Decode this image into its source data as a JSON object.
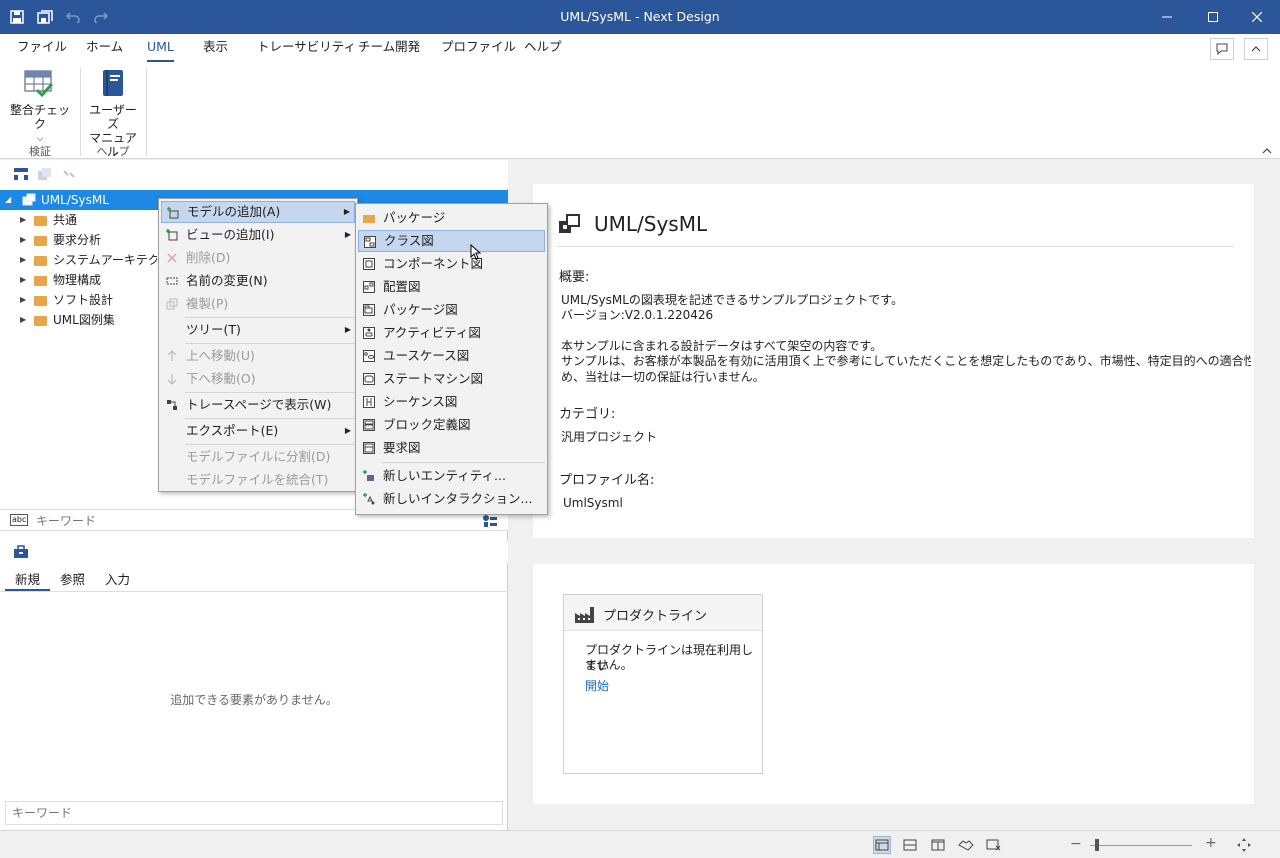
{
  "window": {
    "title": "UML/SysML - Next Design"
  },
  "menu": {
    "tabs": [
      "ファイル",
      "ホーム",
      "UML",
      "表示",
      "トレーサビリティ",
      "チーム開発",
      "プロファイル",
      "ヘルプ"
    ]
  },
  "ribbon": {
    "check_label_1": "整合チェック",
    "check_group": "検証",
    "manual_label_1": "ユーザーズ",
    "manual_label_2": "マニュアル",
    "help_group": "ヘルプ"
  },
  "tree": {
    "root": "UML/SysML",
    "items": [
      "共通",
      "要求分析",
      "システムアーキテクチャ",
      "物理構成",
      "ソフト設計",
      "UML図例集"
    ]
  },
  "context_menu": {
    "items": [
      {
        "label": "モデルの追加(A)"
      },
      {
        "label": "ビューの追加(I)"
      },
      {
        "label": "削除(D)"
      },
      {
        "label": "名前の変更(N)"
      },
      {
        "label": "複製(P)"
      },
      {
        "label": "ツリー(T)"
      },
      {
        "label": "上へ移動(U)"
      },
      {
        "label": "下へ移動(O)"
      },
      {
        "label": "トレースページで表示(W)"
      },
      {
        "label": "エクスポート(E)"
      },
      {
        "label": "モデルファイルに分割(D)"
      },
      {
        "label": "モデルファイルを統合(T)"
      }
    ]
  },
  "submenu": {
    "items": [
      {
        "label": "パッケージ"
      },
      {
        "label": "クラス図"
      },
      {
        "label": "コンポーネント図"
      },
      {
        "label": "配置図"
      },
      {
        "label": "パッケージ図"
      },
      {
        "label": "アクティビティ図"
      },
      {
        "label": "ユースケース図"
      },
      {
        "label": "ステートマシン図"
      },
      {
        "label": "シーケンス図"
      },
      {
        "label": "ブロック定義図"
      },
      {
        "label": "要求図"
      },
      {
        "label": "新しいエンティティ..."
      },
      {
        "label": "新しいインタラクション..."
      }
    ]
  },
  "search": {
    "placeholder": "キーワード"
  },
  "toolbox": {
    "tabs": [
      "新規",
      "参照",
      "入力"
    ],
    "empty_message": "追加できる要素がありません。",
    "search_placeholder": "キーワード"
  },
  "info": {
    "title": "UML/SysML",
    "overview_label": "概要:",
    "overview_line1": "UML/SysMLの図表現を記述できるサンプルプロジェクトです。",
    "overview_line2": "バージョン:V2.0.1.220426",
    "overview_line3": "本サンプルに含まれる設計データはすべて架空の内容です。",
    "overview_line4": "サンプルは、お客様が本製品を有効に活用頂く上で参考にしていただくことを想定したものであり、市場性、特定目的への適合性の保証を含",
    "overview_line5": "め、当社は一切の保証は行いません。",
    "category_label": "カテゴリ:",
    "category_value": "汎用プロジェクト",
    "profile_label": "プロファイル名:",
    "profile_value": "UmlSysml"
  },
  "productline": {
    "title": "プロダクトライン",
    "message_1": "プロダクトラインは現在利用してい",
    "message_2": "ません。",
    "link": "開始"
  },
  "colors": {
    "title_bar": "#2b579a",
    "selection": "#1e88e5",
    "highlight": "#c5d7ef",
    "link": "#1f6fc0"
  }
}
